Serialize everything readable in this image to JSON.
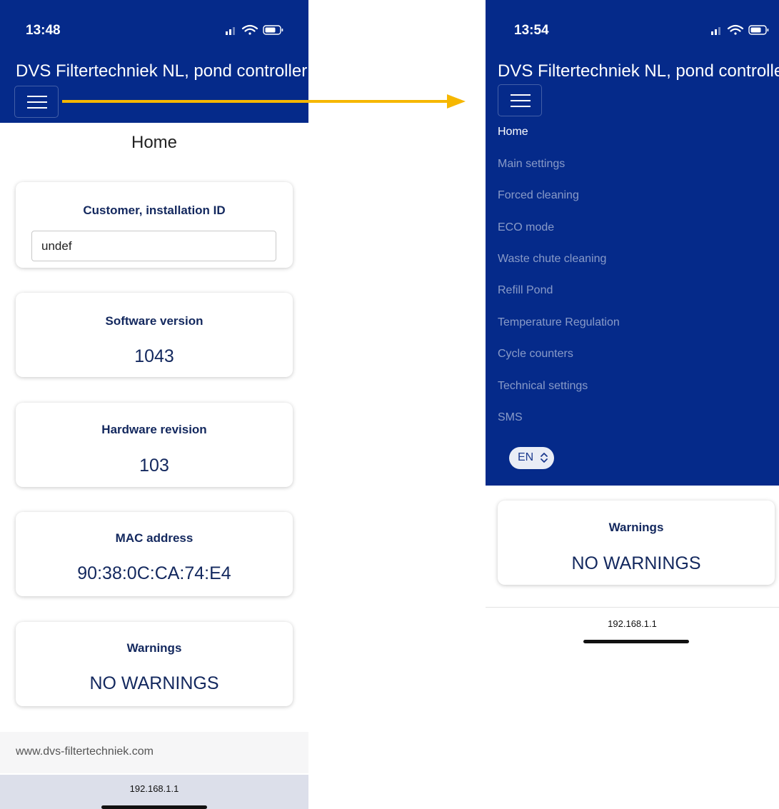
{
  "left_screen": {
    "status_time": "13:48",
    "app_title": "DVS Filtertechniek NL, pond controller",
    "page_title": "Home",
    "customer_card": {
      "title": "Customer, installation ID",
      "input_value": "undef"
    },
    "software_card": {
      "title": "Software version",
      "value": "1043"
    },
    "hardware_card": {
      "title": "Hardware revision",
      "value": "103"
    },
    "mac_card": {
      "title": "MAC address",
      "value": "90:38:0C:CA:74:E4"
    },
    "warnings_card": {
      "title": "Warnings",
      "value": "NO WARNINGS"
    },
    "footer_link": "www.dvs-filtertechniek.com",
    "url": "192.168.1.1"
  },
  "right_screen": {
    "status_time": "13:54",
    "app_title": "DVS Filtertechniek NL, pond controller",
    "menu_items": [
      "Home",
      "Main settings",
      "Forced cleaning",
      "ECO mode",
      "Waste chute cleaning",
      "Refill Pond",
      "Temperature Regulation",
      "Cycle counters",
      "Technical settings",
      "SMS"
    ],
    "active_menu_item": "Home",
    "language": "EN",
    "warnings_card": {
      "title": "Warnings",
      "value": "NO WARNINGS"
    },
    "url": "192.168.1.1"
  },
  "icons": {
    "status_icons": [
      "signal-icon",
      "wifi-icon",
      "battery-icon"
    ],
    "menu_toggle": "hamburger-menu-icon",
    "annotation": "arrow-icon"
  },
  "colors": {
    "header_blue": "#052a8a",
    "card_text_navy": "#13285e",
    "annotation_arrow": "#f6b700",
    "browser_bar": "#dcdfea"
  }
}
